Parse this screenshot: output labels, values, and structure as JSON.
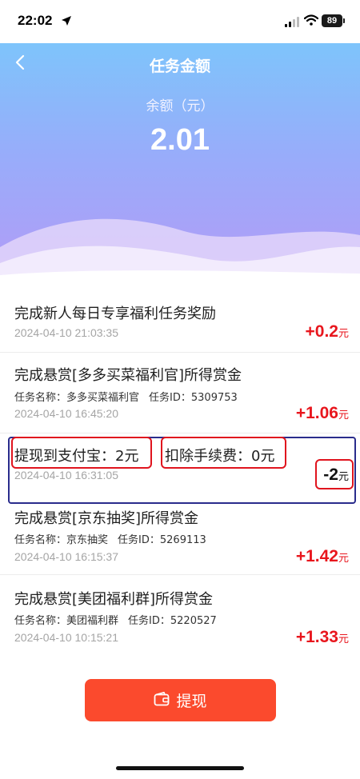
{
  "status_bar": {
    "time": "22:02",
    "battery": "89"
  },
  "header": {
    "title": "任务金额",
    "balance_label": "余额（元）",
    "balance_value": "2.01"
  },
  "records": [
    {
      "title": "完成新人每日专享福利任务奖励",
      "time": "2024-04-10 21:03:35",
      "amount": "+0.2",
      "unit": "元"
    },
    {
      "title": "完成悬赏[多多买菜福利官]所得赏金",
      "task_name_label": "任务名称：",
      "task_name": "多多买菜福利官",
      "task_id_label": "任务ID：",
      "task_id": "5309753",
      "time": "2024-04-10 16:45:20",
      "amount": "+1.06",
      "unit": "元"
    },
    {
      "title_part1": "提现到支付宝：2元",
      "title_part2": "扣除手续费：0元",
      "time": "2024-04-10 16:31:05",
      "amount": "-2",
      "unit": "元"
    },
    {
      "title": "完成悬赏[京东抽奖]所得赏金",
      "task_name_label": "任务名称：",
      "task_name": "京东抽奖",
      "task_id_label": "任务ID：",
      "task_id": "5269113",
      "time": "2024-04-10 16:15:37",
      "amount": "+1.42",
      "unit": "元"
    },
    {
      "title": "完成悬赏[美团福利群]所得赏金",
      "task_name_label": "任务名称：",
      "task_name": "美团福利群",
      "task_id_label": "任务ID：",
      "task_id": "5220527",
      "time": "2024-04-10 10:15:21",
      "amount": "+1.33",
      "unit": "元"
    }
  ],
  "withdraw_button": {
    "label": "提现"
  },
  "icons": {
    "back": "chevron-left-icon",
    "wallet": "wallet-icon",
    "location": "location-arrow-icon",
    "signal": "cellular-signal-icon",
    "wifi": "wifi-icon"
  },
  "colors": {
    "accent": "#fb4a2d",
    "amount": "#e8161d",
    "header_top": "#7ec4fb",
    "header_bottom": "#b39bf7"
  }
}
